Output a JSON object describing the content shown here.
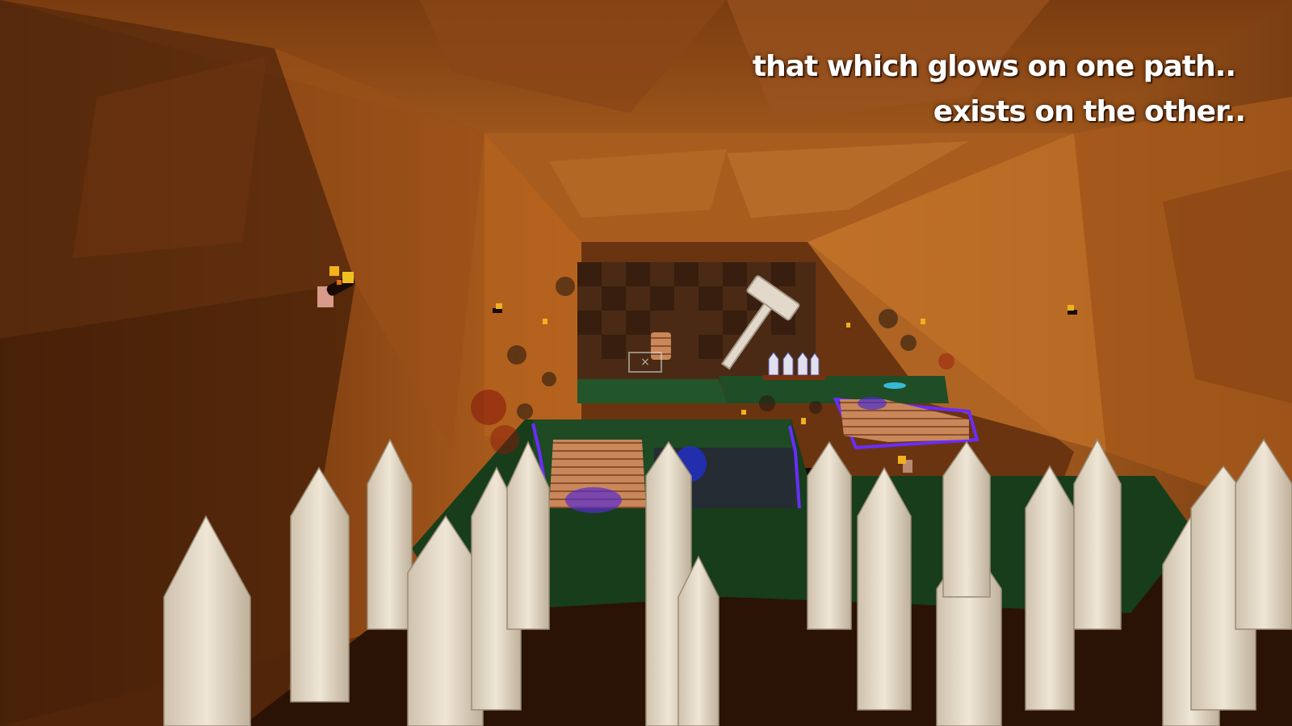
{
  "hint": {
    "line1": "that which glows on one path..",
    "line2": "exists on the other.."
  },
  "crosshair": {
    "glyph": "×"
  },
  "colors": {
    "cave_light": "#c9762a",
    "cave_dark": "#5a2d0c",
    "grass": "#1f4a22",
    "glow_purple": "#6a2cff",
    "stake": "#e7dccd"
  },
  "icons": {
    "hammer": "hammer-icon",
    "torch": "torch-icon",
    "crosshair": "crosshair-icon"
  }
}
